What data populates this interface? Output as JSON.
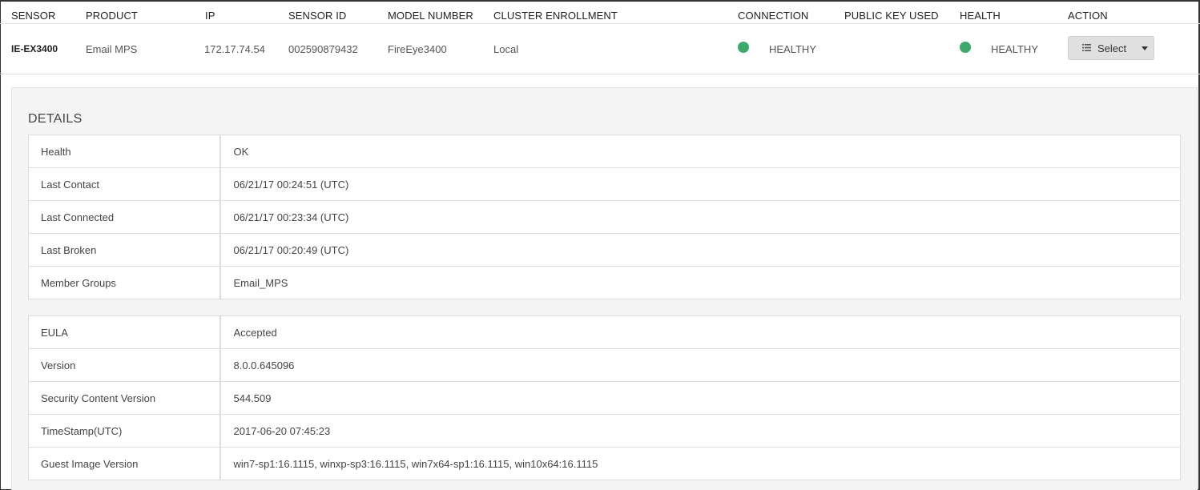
{
  "columns": {
    "sensor": "SENSOR",
    "product": "PRODUCT",
    "ip": "IP",
    "sensor_id": "SENSOR ID",
    "model_number": "MODEL NUMBER",
    "cluster_enrollment": "CLUSTER ENROLLMENT",
    "connection": "CONNECTION",
    "public_key_used": "PUBLIC KEY USED",
    "health": "HEALTH",
    "action": "ACTION"
  },
  "row": {
    "sensor": "IE-EX3400",
    "product": "Email MPS",
    "ip": "172.17.74.54",
    "sensor_id": "002590879432",
    "model_number": "FireEye3400",
    "cluster_enrollment": "Local",
    "connection": "HEALTHY",
    "public_key_used": "",
    "health": "HEALTHY",
    "action_label": "Select",
    "status_color": "#3daa6b"
  },
  "details": {
    "title": "DETAILS",
    "group1": [
      {
        "key": "Health",
        "value": "OK"
      },
      {
        "key": "Last Contact",
        "value": "06/21/17 00:24:51 (UTC)"
      },
      {
        "key": "Last Connected",
        "value": "06/21/17 00:23:34 (UTC)"
      },
      {
        "key": "Last Broken",
        "value": "06/21/17 00:20:49 (UTC)"
      },
      {
        "key": "Member Groups",
        "value": "Email_MPS"
      }
    ],
    "group2": [
      {
        "key": "EULA",
        "value": "Accepted"
      },
      {
        "key": "Version",
        "value": "8.0.0.645096"
      },
      {
        "key": "Security Content Version",
        "value": "544.509"
      },
      {
        "key": "TimeStamp(UTC)",
        "value": "2017-06-20 07:45:23"
      },
      {
        "key": "Guest Image Version",
        "value": "win7-sp1:16.1115, winxp-sp3:16.1115, win7x64-sp1:16.1115, win10x64:16.1115"
      }
    ]
  },
  "icons": {
    "action_list": "list-icon",
    "action_caret": "caret-down-icon",
    "status": "status-dot-icon"
  }
}
